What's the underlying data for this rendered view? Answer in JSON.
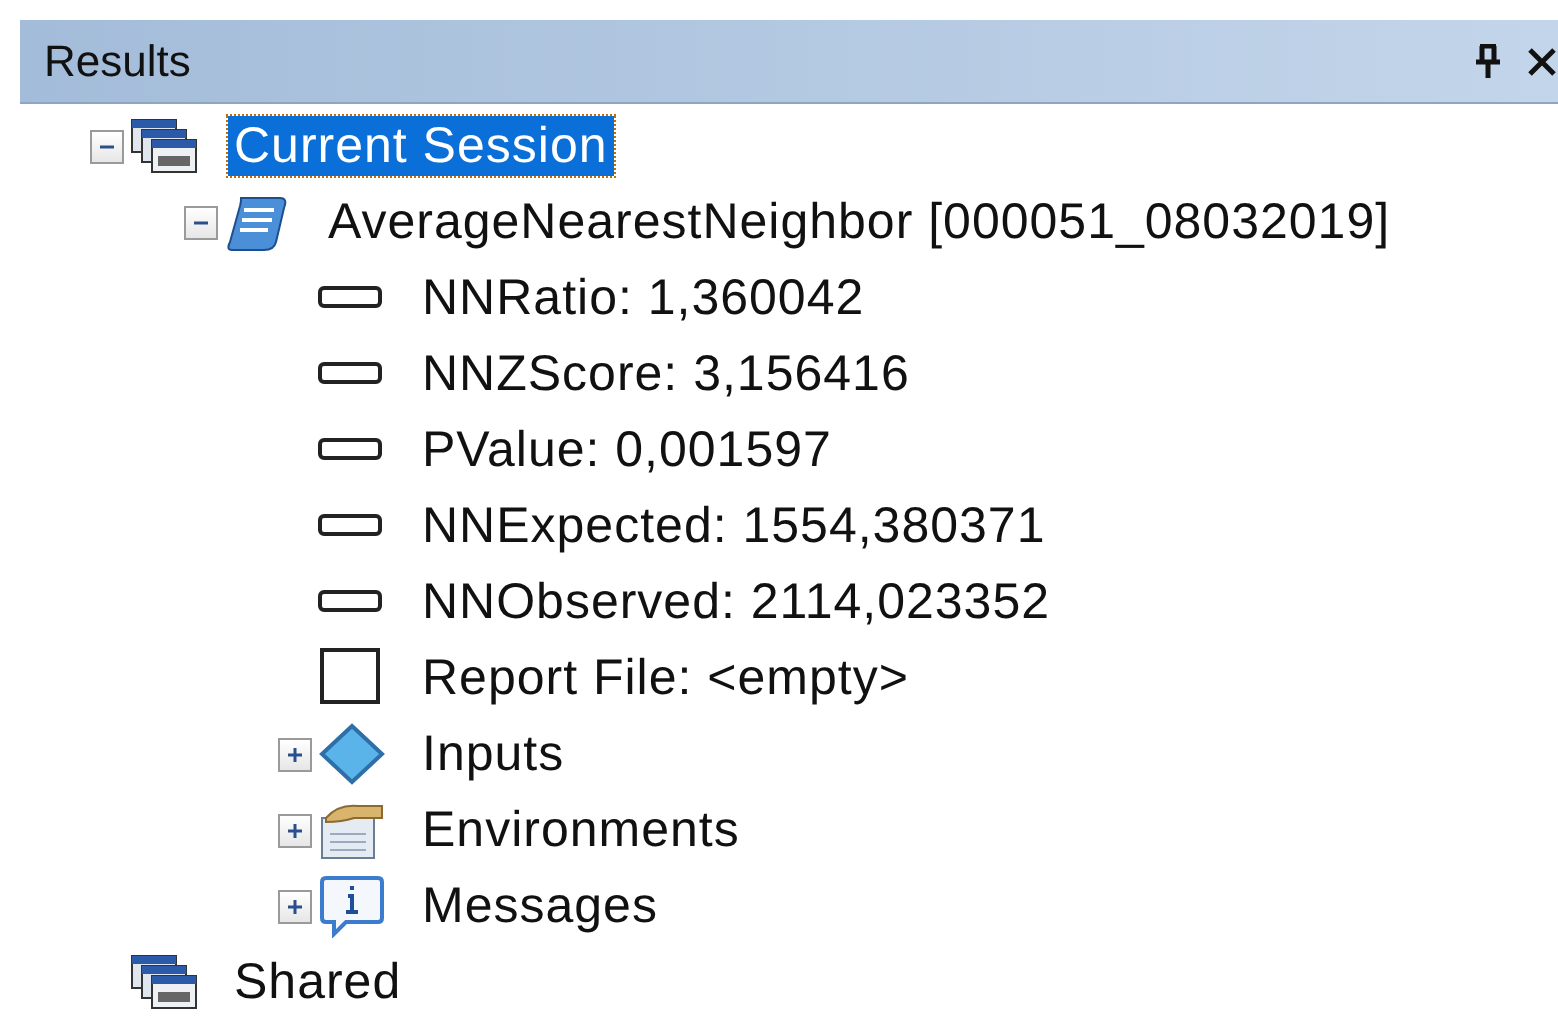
{
  "panel": {
    "title": "Results"
  },
  "tree": [
    {
      "label": "Current Session",
      "kind": "session",
      "expanded": true,
      "selected": true,
      "children": [
        {
          "label": "AverageNearestNeighbor [000051_08032019]",
          "kind": "tool",
          "expanded": true,
          "selected": false,
          "children": [
            {
              "label": "NNRatio: 1,360042",
              "kind": "value",
              "selected": false
            },
            {
              "label": "NNZScore: 3,156416",
              "kind": "value",
              "selected": false
            },
            {
              "label": "PValue: 0,001597",
              "kind": "value",
              "selected": false
            },
            {
              "label": "NNExpected: 1554,380371",
              "kind": "value",
              "selected": false
            },
            {
              "label": "NNObserved: 2114,023352",
              "kind": "value",
              "selected": false
            },
            {
              "label": "Report File: <empty>",
              "kind": "file",
              "selected": false
            },
            {
              "label": "Inputs",
              "kind": "inputs",
              "expanded": false,
              "selected": false
            },
            {
              "label": "Environments",
              "kind": "environments",
              "expanded": false,
              "selected": false
            },
            {
              "label": "Messages",
              "kind": "messages",
              "expanded": false,
              "selected": false
            }
          ]
        }
      ]
    },
    {
      "label": "Shared",
      "kind": "session",
      "selected": false
    }
  ]
}
